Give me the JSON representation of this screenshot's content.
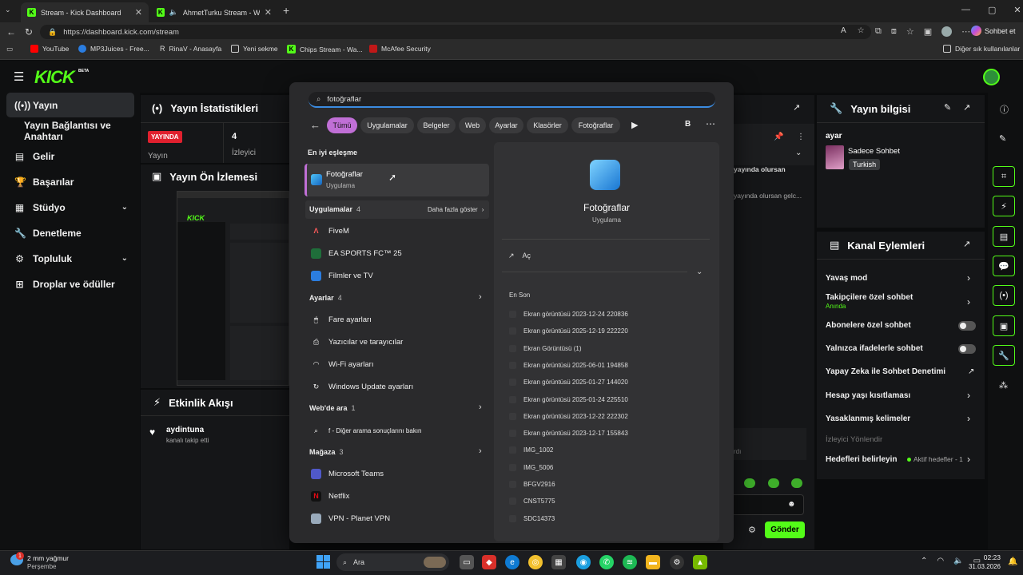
{
  "browser": {
    "tabs": [
      {
        "title": "Stream - Kick Dashboard",
        "active": true
      },
      {
        "title": "AhmetTurku Stream - Watch L",
        "active": false
      }
    ],
    "url": "https://dashboard.kick.com/stream",
    "profile_button": "Sohbet et",
    "bookmarks": [
      "YouTube",
      "MP3Juices - Free...",
      "RinaV - Anasayfa",
      "Yeni sekme",
      "Chips Stream - Wa...",
      "McAfee Security"
    ],
    "other_bookmarks": "Diğer sık kullanılanlar"
  },
  "kick": {
    "logo": "KICK",
    "logo_badge": "BETA",
    "sidebar": [
      {
        "label": "Yayın",
        "icon": "broadcast-icon",
        "selected": true
      },
      {
        "label": "Yayın Bağlantısı ve Anahtarı",
        "icon": "",
        "selected": false
      },
      {
        "label": "Gelir",
        "icon": "chart-icon",
        "selected": false
      },
      {
        "label": "Başarılar",
        "icon": "trophy-icon",
        "selected": false
      },
      {
        "label": "Stüdyo",
        "icon": "studio-icon",
        "selected": false,
        "chevron": true
      },
      {
        "label": "Denetleme",
        "icon": "wrench-icon",
        "selected": false
      },
      {
        "label": "Topluluk",
        "icon": "community-icon",
        "selected": false,
        "chevron": true
      },
      {
        "label": "Droplar ve ödüller",
        "icon": "gift-icon",
        "selected": false
      }
    ],
    "stats": {
      "title": "Yayın İstatistikleri",
      "live_badge": "YAYINDA",
      "live_label": "Yayın",
      "viewers_value": "4",
      "viewers_label": "İzleyici"
    },
    "preview_title": "Yayın Ön İzlemesi",
    "activity": {
      "title": "Etkinlik Akışı",
      "user": "aydintuna",
      "event": "kanalı takip etti"
    },
    "chat": {
      "line1": "yayında olursan",
      "line2": "yayında olursan gelc...",
      "placeholder_fragment": "rdı",
      "send_button": "Gönder"
    },
    "stream_info": {
      "title": "Yayın bilgisi",
      "stream_title": "ayar",
      "category": "Sadece Sohbet",
      "language": "Turkish"
    },
    "channel_actions": {
      "title": "Kanal Eylemleri",
      "items": [
        {
          "label": "Yavaş mod",
          "type": "arrow"
        },
        {
          "label": "Takipçilere özel sohbet",
          "sub": "Anında",
          "type": "arrow"
        },
        {
          "label": "Abonelere özel sohbet",
          "type": "toggle"
        },
        {
          "label": "Yalnızca ifadelerle sohbet",
          "type": "toggle"
        },
        {
          "label": "Yapay Zeka ile Sohbet Denetimi",
          "type": "external"
        },
        {
          "label": "Hesap yaşı kısıtlaması",
          "type": "arrow"
        },
        {
          "label": "Yasaklanmış kelimeler",
          "type": "arrow"
        }
      ],
      "redirect_label": "İzleyici Yönlendir",
      "goals_label": "Hedefleri belirleyin",
      "goals_status": "Aktif hedefler - 1"
    }
  },
  "search": {
    "query": "fotoğraflar",
    "filters": [
      "Tümü",
      "Uygulamalar",
      "Belgeler",
      "Web",
      "Ayarlar",
      "Klasörler",
      "Fotoğraflar"
    ],
    "avatar_letter": "B",
    "best_match_label": "En iyi eşleşme",
    "best_match": {
      "name": "Fotoğraflar",
      "type": "Uygulama"
    },
    "apps_section": {
      "label": "Uygulamalar",
      "count": "4",
      "more": "Daha fazla göster"
    },
    "apps": [
      "FiveM",
      "EA SPORTS FC™ 25",
      "Filmler ve TV"
    ],
    "settings_section": {
      "label": "Ayarlar",
      "count": "4"
    },
    "settings": [
      "Fare ayarları",
      "Yazıcılar ve tarayıcılar",
      "Wi-Fi ayarları",
      "Windows Update ayarları"
    ],
    "web_section": {
      "label": "Web'de ara",
      "count": "1"
    },
    "web_item": "f - Diğer arama sonuçlarını bakın",
    "store_section": {
      "label": "Mağaza",
      "count": "3"
    },
    "store": [
      "Microsoft Teams",
      "Netflix",
      "VPN - Planet VPN"
    ],
    "detail": {
      "name": "Fotoğraflar",
      "type": "Uygulama",
      "open": "Aç",
      "recent_label": "En Son",
      "recent": [
        "Ekran görüntüsü 2023-12-24 220836",
        "Ekran görüntüsü 2025-12-19 222220",
        "Ekran Görüntüsü (1)",
        "Ekran görüntüsü 2025-06-01 194858",
        "Ekran görüntüsü 2025-01-27 144020",
        "Ekran görüntüsü 2025-01-24 225510",
        "Ekran görüntüsü 2023-12-22 222302",
        "Ekran görüntüsü 2023-12-17 155843",
        "IMG_1002",
        "IMG_5006",
        "BFGV2916",
        "CNST5775",
        "SDC14373"
      ]
    }
  },
  "taskbar": {
    "weather": "2 mm yağmur",
    "weather_day": "Perşembe",
    "weather_badge": "1",
    "search_label": "Ara",
    "time": "02:23",
    "date": "31.03.2026"
  },
  "colors": {
    "kick_green": "#53fc18",
    "live_red": "#e0202e",
    "filter_active": "#c06fd6",
    "search_bg": "#2a2a2c"
  }
}
